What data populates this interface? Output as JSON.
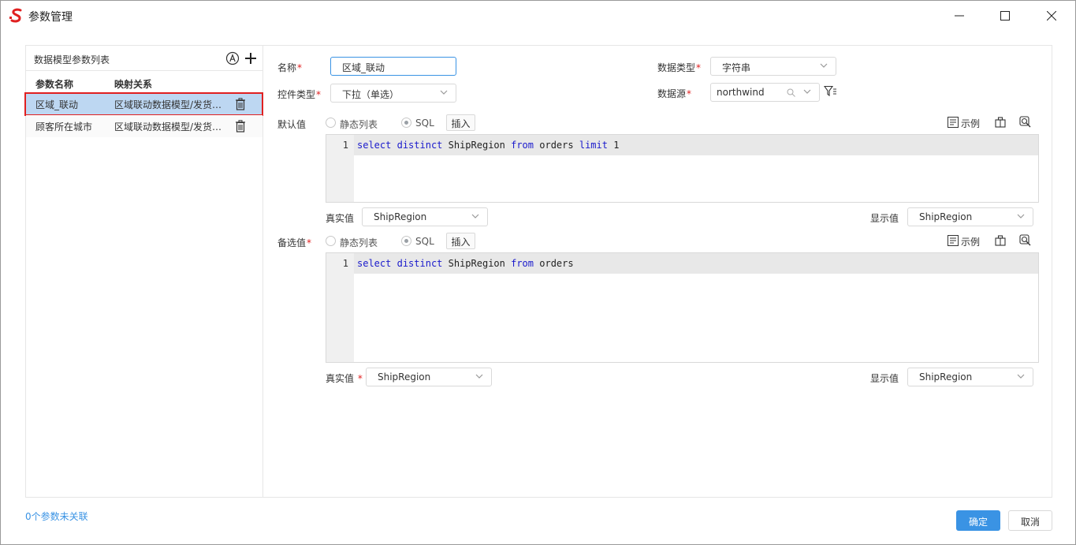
{
  "window": {
    "title": "参数管理",
    "logo_icon": "app-logo-icon",
    "accent": "#3a93e4"
  },
  "left": {
    "title": "数据模型参数列表",
    "columns": {
      "name": "参数名称",
      "mapping": "映射关系"
    },
    "rows": [
      {
        "name": "区域_联动",
        "mapping": "区域联动数据模型/发货区域",
        "selected": true
      },
      {
        "name": "顾客所在城市",
        "mapping": "区域联动数据模型/发货城市",
        "selected": false
      }
    ]
  },
  "form": {
    "name_label": "名称",
    "name_value": "区域_联动",
    "data_type_label": "数据类型",
    "data_type_value": "字符串",
    "control_type_label": "控件类型",
    "control_type_value": "下拉（单选）",
    "datasource_label": "数据源",
    "datasource_value": "northwind",
    "default": {
      "label": "默认值",
      "radio_static": "静态列表",
      "radio_sql": "SQL",
      "insert": "插入",
      "example": "示例",
      "line_no": "1",
      "code": {
        "k1": "select",
        "k2": "distinct",
        "t1": "ShipRegion",
        "k3": "from",
        "t2": "orders",
        "k4": "limit",
        "t3": "1"
      },
      "real_label": "真实值",
      "real_value": "ShipRegion",
      "display_label": "显示值",
      "display_value": "ShipRegion"
    },
    "options": {
      "label": "备选值",
      "radio_static": "静态列表",
      "radio_sql": "SQL",
      "insert": "插入",
      "example": "示例",
      "line_no": "1",
      "code": {
        "k1": "select",
        "k2": "distinct",
        "t1": "ShipRegion",
        "k3": "from",
        "t2": "orders"
      },
      "real_label": "真实值",
      "real_value": "ShipRegion",
      "display_label": "显示值",
      "display_value": "ShipRegion"
    }
  },
  "footer": {
    "unlinked": "0个参数未关联",
    "ok": "确定",
    "cancel": "取消"
  }
}
